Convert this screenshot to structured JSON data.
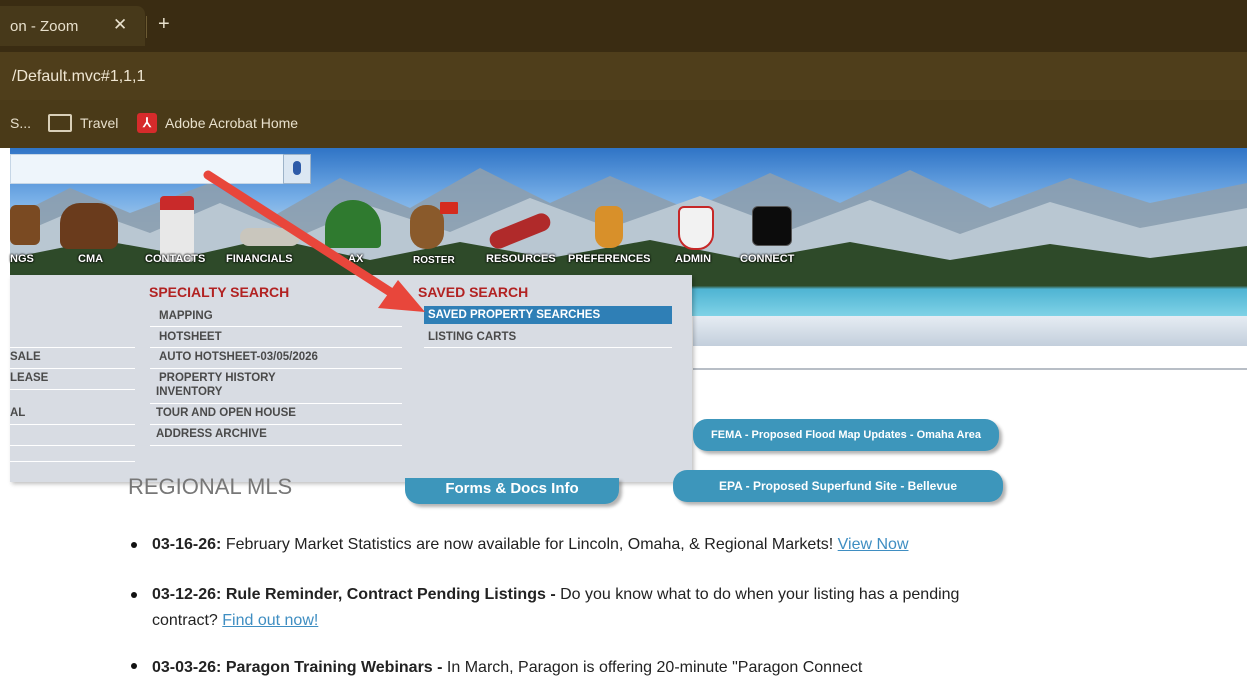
{
  "browser": {
    "tab_title": "on - Zoom",
    "tab_close": "✕",
    "new_tab": "+",
    "url": "/Default.mvc#1,1,1",
    "bookmarks": [
      {
        "label": "S..."
      },
      {
        "label": "Travel",
        "icon": "folder-icon"
      },
      {
        "label": "Adobe Acrobat Home",
        "icon": "pdf-icon"
      }
    ]
  },
  "nav": {
    "items": [
      {
        "label": "NGS",
        "icon": "moose-icon"
      },
      {
        "label": "CMA",
        "icon": "bear-icon"
      },
      {
        "label": "CONTACTS",
        "icon": "hockey-player-icon"
      },
      {
        "label": "FINANCIALS",
        "icon": "rocks-icon"
      },
      {
        "label": "AX",
        "icon": "trees-icon"
      },
      {
        "label": "ROSTER",
        "icon": "beaver-icon"
      },
      {
        "label": "RESOURCES",
        "icon": "canoe-icon"
      },
      {
        "label": "PREFERENCES",
        "icon": "maple-syrup-icon"
      },
      {
        "label": "ADMIN",
        "icon": "shield-icon"
      },
      {
        "label": "CONNECT",
        "icon": "mountain-logo-icon"
      }
    ]
  },
  "menu": {
    "left_col": [
      "SALE",
      "LEASE",
      "AL"
    ],
    "specialty": {
      "title": "SPECIALTY SEARCH",
      "items": [
        "MAPPING",
        "HOTSHEET",
        "AUTO HOTSHEET-03/05/2026",
        "PROPERTY HISTORY",
        "INVENTORY",
        "TOUR AND OPEN HOUSE",
        "ADDRESS ARCHIVE"
      ]
    },
    "saved": {
      "title": "SAVED SEARCH",
      "items": [
        "SAVED PROPERTY SEARCHES",
        "LISTING CARTS"
      ]
    }
  },
  "buttons": {
    "fema": "FEMA - Proposed Flood Map Updates - Omaha Area",
    "forms": "Forms & Docs Info",
    "epa": "EPA - Proposed Superfund Site - Bellevue"
  },
  "content": {
    "heading": "REGIONAL MLS",
    "news": [
      {
        "date": "03-16-26:",
        "title": "",
        "text": "February Market Statistics are now available for Lincoln, Omaha, & Regional Markets!",
        "link": "View Now"
      },
      {
        "date": "03-12-26:",
        "title": "Rule Reminder, Contract Pending Listings -",
        "text": "Do you know what to do when your listing has a pending contract?",
        "link": "Find out now!"
      },
      {
        "date": "03-03-26:",
        "title": "Paragon Training Webinars -",
        "text": "In March, Paragon is offering 20-minute \"Paragon Connect",
        "link": ""
      }
    ]
  },
  "colors": {
    "accent_red": "#b22222",
    "highlight": "#2f7fb6",
    "button": "#3d96bb",
    "arrow": "#e8463b"
  }
}
